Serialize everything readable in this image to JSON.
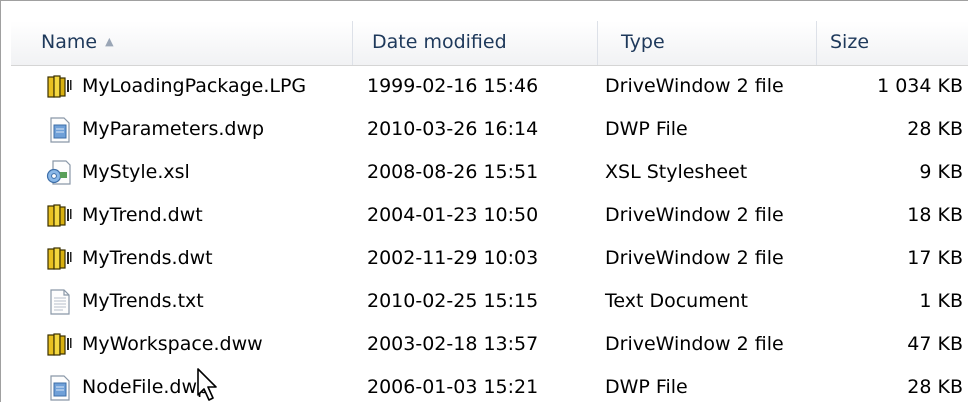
{
  "columns": {
    "name": "Name",
    "date": "Date modified",
    "type": "Type",
    "size": "Size"
  },
  "files": [
    {
      "name": "MyLoadingPackage.LPG",
      "date": "1999-02-16 15:46",
      "type": "DriveWindow 2 file",
      "size": "1 034 KB",
      "icon": "drivewindow-icon"
    },
    {
      "name": "MyParameters.dwp",
      "date": "2010-03-26 16:14",
      "type": "DWP File",
      "size": "28 KB",
      "icon": "dwp-file-icon"
    },
    {
      "name": "MyStyle.xsl",
      "date": "2008-08-26 15:51",
      "type": "XSL Stylesheet",
      "size": "9 KB",
      "icon": "xsl-stylesheet-icon"
    },
    {
      "name": "MyTrend.dwt",
      "date": "2004-01-23 10:50",
      "type": "DriveWindow 2 file",
      "size": "18 KB",
      "icon": "drivewindow-icon"
    },
    {
      "name": "MyTrends.dwt",
      "date": "2002-11-29 10:03",
      "type": "DriveWindow 2 file",
      "size": "17 KB",
      "icon": "drivewindow-icon"
    },
    {
      "name": "MyTrends.txt",
      "date": "2010-02-25 15:15",
      "type": "Text Document",
      "size": "1 KB",
      "icon": "text-document-icon"
    },
    {
      "name": "MyWorkspace.dww",
      "date": "2003-02-18 13:57",
      "type": "DriveWindow 2 file",
      "size": "47 KB",
      "icon": "drivewindow-icon"
    },
    {
      "name": "NodeFile.dwp",
      "date": "2006-01-03 15:21",
      "type": "DWP File",
      "size": "28 KB",
      "icon": "dwp-file-icon"
    }
  ]
}
